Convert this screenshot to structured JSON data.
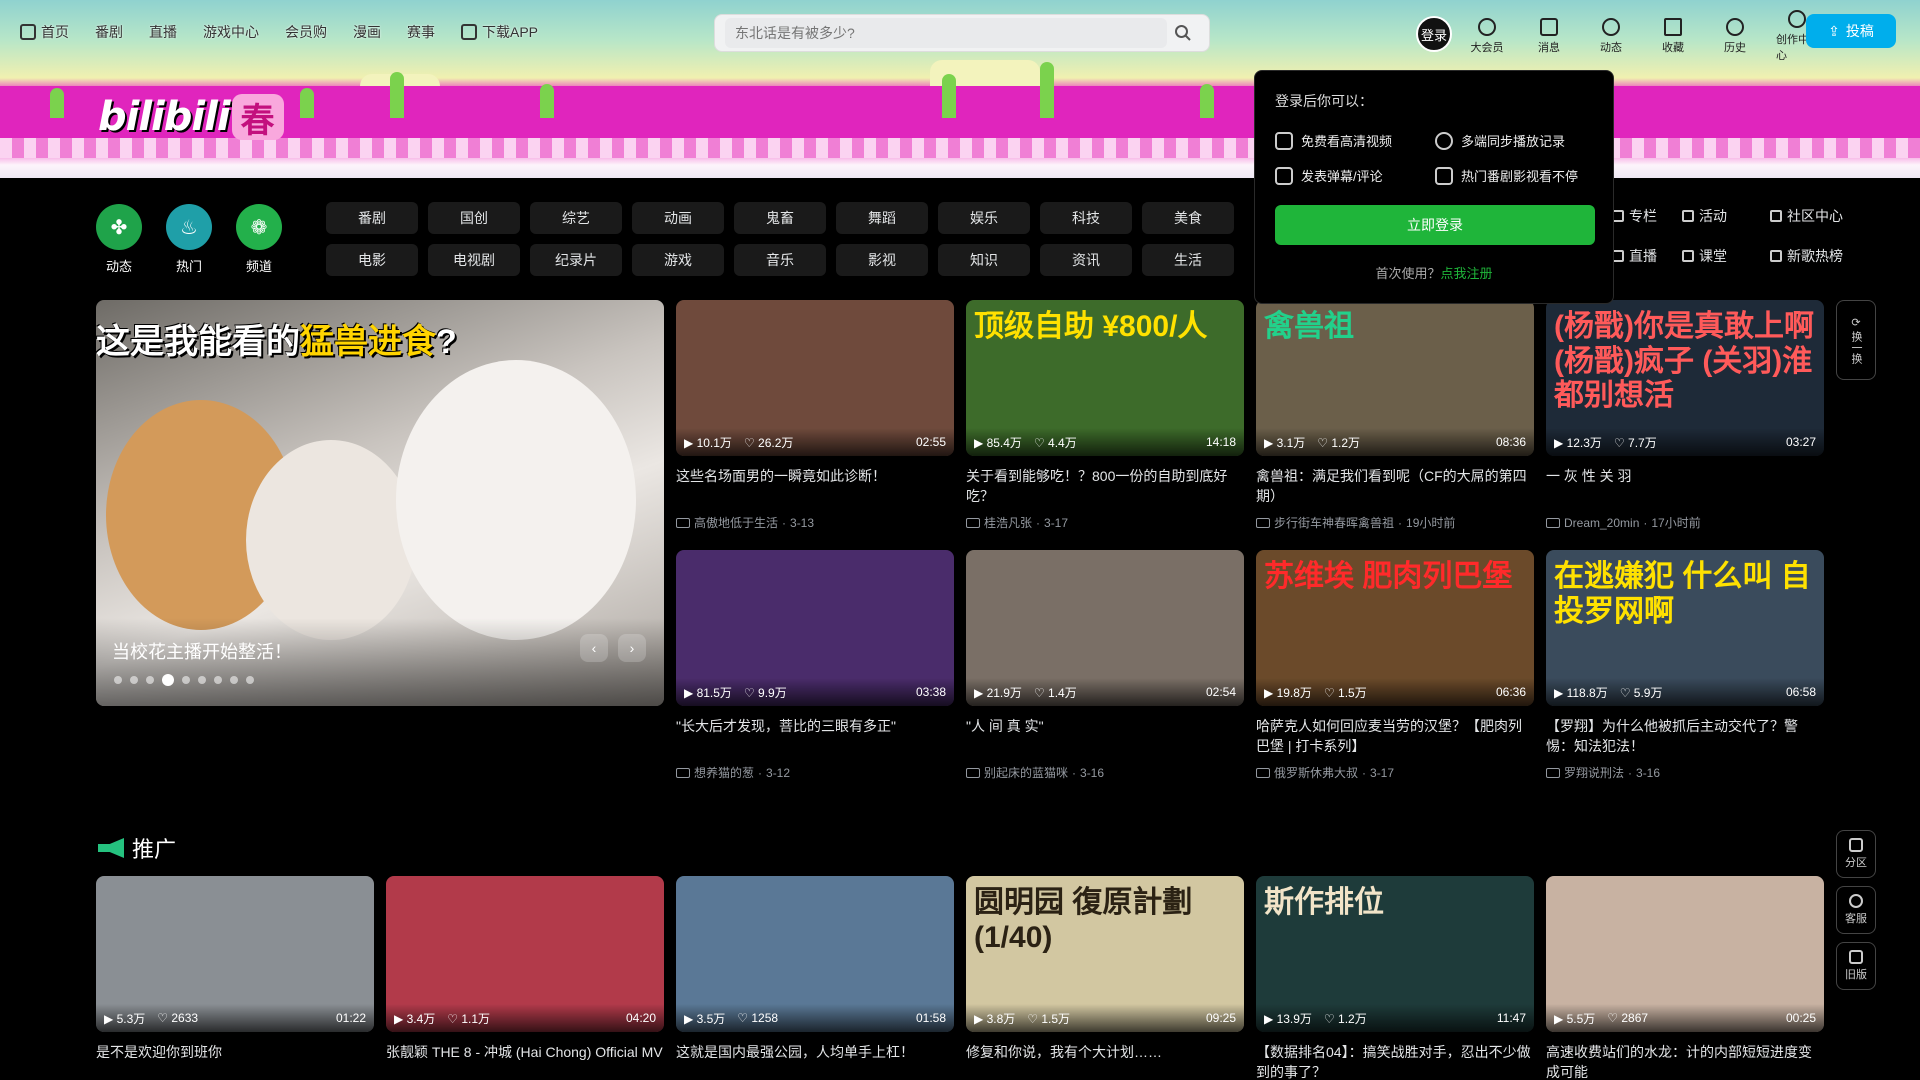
{
  "header": {
    "nav": [
      "首页",
      "番剧",
      "直播",
      "游戏中心",
      "会员购",
      "漫画",
      "赛事",
      "下载APP"
    ],
    "search_placeholder": "东北话是有被多少?",
    "login_label": "登录",
    "tools": [
      "大会员",
      "消息",
      "动态",
      "收藏",
      "历史",
      "创作中心"
    ],
    "upload_label": "投稿",
    "logo_word": "bilibili",
    "logo_mark": "春"
  },
  "quick": [
    {
      "label": "动态",
      "color": "#1fa34a",
      "glyph": "✤"
    },
    {
      "label": "热门",
      "color": "#1f9fa8",
      "glyph": "♨"
    },
    {
      "label": "频道",
      "color": "#23b04b",
      "glyph": "❁"
    }
  ],
  "categories": [
    "番剧",
    "国创",
    "综艺",
    "动画",
    "鬼畜",
    "舞蹈",
    "娱乐",
    "科技",
    "美食",
    "电影",
    "电视剧",
    "纪录片",
    "游戏",
    "音乐",
    "影视",
    "知识",
    "资讯",
    "生活"
  ],
  "side_links": [
    "专栏",
    "活动",
    "社区中心",
    "直播",
    "课堂",
    "新歌热榜"
  ],
  "login_popup": {
    "hint": "登录后你可以：",
    "perks": [
      "免费看高清视频",
      "多端同步播放记录",
      "发表弹幕/评论",
      "热门番剧影视看不停"
    ],
    "button": "立即登录",
    "register_prefix": "首次使用？",
    "register_link": "点我注册"
  },
  "carousel": {
    "headline_a": "这是我能看的",
    "headline_b": "猛兽进食",
    "headline_c": "?",
    "caption": "当校花主播开始整活！",
    "slide_count": 9,
    "active_index": 3
  },
  "videos": [
    {
      "title": "这些名场面男的一瞬竟如此诊断！",
      "views": "10.1万",
      "likes": "26.2万",
      "duration": "02:55",
      "up": "高傲地低于生活",
      "date": "3-13",
      "thumb_text": "",
      "bg": "#6f4a3c",
      "fg": "#fff"
    },
    {
      "title": "关于看到能够吃！？800一份的自助到底好吃？",
      "views": "85.4万",
      "likes": "4.4万",
      "duration": "14:18",
      "up": "桂浩凡张",
      "date": "3-17",
      "thumb_text": "顶级自助 ¥800/人",
      "bg": "#3d6b2a",
      "fg": "#ffe100"
    },
    {
      "title": "禽兽祖：满足我们看到呢（CF的大屌的第四期）",
      "views": "3.1万",
      "likes": "1.2万",
      "duration": "08:36",
      "up": "步行街车神春晖禽兽祖",
      "date": "19小时前",
      "thumb_text": "禽兽祖",
      "bg": "#6b5f4a",
      "fg": "#22d18b"
    },
    {
      "title": "一 灰 性 关 羽",
      "views": "12.3万",
      "likes": "7.7万",
      "duration": "03:27",
      "up": "Dream_20min",
      "date": "17小时前",
      "thumb_text": "(杨戬)你是真敢上啊 (杨戬)疯子 (关羽)淮都别想活",
      "bg": "#1e2a38",
      "fg": "#ff5a5a"
    },
    {
      "title": "\"长大后才发现，菩比的三眼有多正\"",
      "views": "81.5万",
      "likes": "9.9万",
      "duration": "03:38",
      "up": "想养猫的葱",
      "date": "3-12",
      "thumb_text": "",
      "bg": "#4a2c6b",
      "fg": "#fff"
    },
    {
      "title": "\"人 间 真 实\"",
      "views": "21.9万",
      "likes": "1.4万",
      "duration": "02:54",
      "up": "别起床的蓝猫咪",
      "date": "3-16",
      "thumb_text": "",
      "bg": "#7a6f66",
      "fg": "#fff"
    },
    {
      "title": "哈萨克人如何回应麦当劳的汉堡？【肥肉列巴堡 | 打卡系列】",
      "views": "19.8万",
      "likes": "1.5万",
      "duration": "06:36",
      "up": "俄罗斯休弗大叔",
      "date": "3-17",
      "thumb_text": "苏维埃 肥肉列巴堡",
      "bg": "#6b4a2a",
      "fg": "#ff2a2a"
    },
    {
      "title": "【罗翔】为什么他被抓后主动交代了？警惕：知法犯法！",
      "views": "118.8万",
      "likes": "5.9万",
      "duration": "06:58",
      "up": "罗翔说刑法",
      "date": "3-16",
      "thumb_text": "在逃嫌犯 什么叫 自投罗网啊",
      "bg": "#3a4b5c",
      "fg": "#ffe100"
    }
  ],
  "promo_title": "推广",
  "promos": [
    {
      "title": "是不是欢迎你到班你",
      "views": "5.3万",
      "likes": "2633",
      "duration": "01:22",
      "thumb_text": "",
      "bg": "#8a8f94",
      "fg": "#fff"
    },
    {
      "title": "张靓颖 THE 8 - 冲城 (Hai Chong) Official MV",
      "views": "3.4万",
      "likes": "1.1万",
      "duration": "04:20",
      "thumb_text": "",
      "bg": "#b23a4a",
      "fg": "#fff"
    },
    {
      "title": "这就是国内最强公园，人均单手上杠！",
      "views": "3.5万",
      "likes": "1258",
      "duration": "01:58",
      "thumb_text": "",
      "bg": "#5a7896",
      "fg": "#fff"
    },
    {
      "title": "修复和你说，我有个大计划……",
      "views": "3.8万",
      "likes": "1.5万",
      "duration": "09:25",
      "thumb_text": "圆明园 復原計劃 (1/40)",
      "bg": "#d2c7a1",
      "fg": "#2b2214"
    },
    {
      "title": "【数据排名04】：搞笑战胜对手，忍出不少做到的事了？",
      "views": "13.9万",
      "likes": "1.2万",
      "duration": "11:47",
      "thumb_text": "斯作排位",
      "bg": "#1e3b3a",
      "fg": "#f2e4c8"
    },
    {
      "title": "高速收费站们的水龙：计的内部短短进度变成可能",
      "views": "5.5万",
      "likes": "2867",
      "duration": "00:25",
      "thumb_text": "",
      "bg": "#c8b2a2",
      "fg": "#fff"
    }
  ],
  "floating": {
    "refresh": "换一换",
    "btn1": "分区",
    "btn2": "客服",
    "btn3": "旧版"
  }
}
